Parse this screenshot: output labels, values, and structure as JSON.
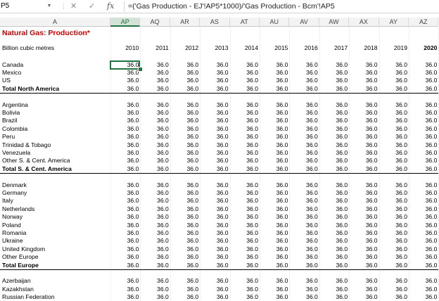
{
  "formula_bar": {
    "name_box": "P5",
    "cancel_icon": "✕",
    "enter_icon": "✓",
    "fx_label": "fx",
    "formula": "=('Gas Production - EJ'!AP5*1000)/'Gas Production - Bcm'!AP5"
  },
  "columns": [
    "A",
    "AP",
    "AQ",
    "AR",
    "AS",
    "AT",
    "AU",
    "AV",
    "AW",
    "AX",
    "AY",
    "AZ"
  ],
  "selected_column": "AP",
  "title": "Natural Gas: Production*",
  "unit_label": "Billion cubic metres",
  "years": [
    "2010",
    "2011",
    "2012",
    "2013",
    "2014",
    "2015",
    "2016",
    "2017",
    "2018",
    "2019",
    "2020"
  ],
  "rows": [
    {
      "label": "Canada",
      "values": [
        "36.0",
        "36.0",
        "36.0",
        "36.0",
        "36.0",
        "36.0",
        "36.0",
        "36.0",
        "36.0",
        "36.0",
        "36.0"
      ]
    },
    {
      "label": "Mexico",
      "values": [
        "36.0",
        "36.0",
        "36.0",
        "36.0",
        "36.0",
        "36.0",
        "36.0",
        "36.0",
        "36.0",
        "36.0",
        "36.0"
      ]
    },
    {
      "label": "US",
      "values": [
        "36.0",
        "36.0",
        "36.0",
        "36.0",
        "36.0",
        "36.0",
        "36.0",
        "36.0",
        "36.0",
        "36.0",
        "36.0"
      ]
    },
    {
      "label": "Total North America",
      "total": true,
      "values": [
        "36.0",
        "36.0",
        "36.0",
        "36.0",
        "36.0",
        "36.0",
        "36.0",
        "36.0",
        "36.0",
        "36.0",
        "36.0"
      ]
    },
    {
      "label": "",
      "blank": true
    },
    {
      "label": "Argentina",
      "values": [
        "36.0",
        "36.0",
        "36.0",
        "36.0",
        "36.0",
        "36.0",
        "36.0",
        "36.0",
        "36.0",
        "36.0",
        "36.0"
      ]
    },
    {
      "label": "Bolivia",
      "values": [
        "36.0",
        "36.0",
        "36.0",
        "36.0",
        "36.0",
        "36.0",
        "36.0",
        "36.0",
        "36.0",
        "36.0",
        "36.0"
      ]
    },
    {
      "label": "Brazil",
      "values": [
        "36.0",
        "36.0",
        "36.0",
        "36.0",
        "36.0",
        "36.0",
        "36.0",
        "36.0",
        "36.0",
        "36.0",
        "36.0"
      ]
    },
    {
      "label": "Colombia",
      "values": [
        "36.0",
        "36.0",
        "36.0",
        "36.0",
        "36.0",
        "36.0",
        "36.0",
        "36.0",
        "36.0",
        "36.0",
        "36.0"
      ]
    },
    {
      "label": "Peru",
      "values": [
        "36.0",
        "36.0",
        "36.0",
        "36.0",
        "36.0",
        "36.0",
        "36.0",
        "36.0",
        "36.0",
        "36.0",
        "36.0"
      ]
    },
    {
      "label": "Trinidad & Tobago",
      "values": [
        "36.0",
        "36.0",
        "36.0",
        "36.0",
        "36.0",
        "36.0",
        "36.0",
        "36.0",
        "36.0",
        "36.0",
        "36.0"
      ]
    },
    {
      "label": "Venezuela",
      "values": [
        "36.0",
        "36.0",
        "36.0",
        "36.0",
        "36.0",
        "36.0",
        "36.0",
        "36.0",
        "36.0",
        "36.0",
        "36.0"
      ]
    },
    {
      "label": "Other S. & Cent. America",
      "values": [
        "36.0",
        "36.0",
        "36.0",
        "36.0",
        "36.0",
        "36.0",
        "36.0",
        "36.0",
        "36.0",
        "36.0",
        "36.0"
      ]
    },
    {
      "label": "Total S. & Cent. America",
      "total": true,
      "values": [
        "36.0",
        "36.0",
        "36.0",
        "36.0",
        "36.0",
        "36.0",
        "36.0",
        "36.0",
        "36.0",
        "36.0",
        "36.0"
      ]
    },
    {
      "label": "",
      "blank": true
    },
    {
      "label": "Denmark",
      "values": [
        "36.0",
        "36.0",
        "36.0",
        "36.0",
        "36.0",
        "36.0",
        "36.0",
        "36.0",
        "36.0",
        "36.0",
        "36.0"
      ]
    },
    {
      "label": "Germany",
      "values": [
        "36.0",
        "36.0",
        "36.0",
        "36.0",
        "36.0",
        "36.0",
        "36.0",
        "36.0",
        "36.0",
        "36.0",
        "36.0"
      ]
    },
    {
      "label": "Italy",
      "values": [
        "36.0",
        "36.0",
        "36.0",
        "36.0",
        "36.0",
        "36.0",
        "36.0",
        "36.0",
        "36.0",
        "36.0",
        "36.0"
      ]
    },
    {
      "label": "Netherlands",
      "values": [
        "36.0",
        "36.0",
        "36.0",
        "36.0",
        "36.0",
        "36.0",
        "36.0",
        "36.0",
        "36.0",
        "36.0",
        "36.0"
      ]
    },
    {
      "label": "Norway",
      "values": [
        "36.0",
        "36.0",
        "36.0",
        "36.0",
        "36.0",
        "36.0",
        "36.0",
        "36.0",
        "36.0",
        "36.0",
        "36.0"
      ]
    },
    {
      "label": "Poland",
      "values": [
        "36.0",
        "36.0",
        "36.0",
        "36.0",
        "36.0",
        "36.0",
        "36.0",
        "36.0",
        "36.0",
        "36.0",
        "36.0"
      ]
    },
    {
      "label": "Romania",
      "values": [
        "36.0",
        "36.0",
        "36.0",
        "36.0",
        "36.0",
        "36.0",
        "36.0",
        "36.0",
        "36.0",
        "36.0",
        "36.0"
      ]
    },
    {
      "label": "Ukraine",
      "values": [
        "36.0",
        "36.0",
        "36.0",
        "36.0",
        "36.0",
        "36.0",
        "36.0",
        "36.0",
        "36.0",
        "36.0",
        "36.0"
      ]
    },
    {
      "label": "United Kingdom",
      "values": [
        "36.0",
        "36.0",
        "36.0",
        "36.0",
        "36.0",
        "36.0",
        "36.0",
        "36.0",
        "36.0",
        "36.0",
        "36.0"
      ]
    },
    {
      "label": "Other Europe",
      "values": [
        "36.0",
        "36.0",
        "36.0",
        "36.0",
        "36.0",
        "36.0",
        "36.0",
        "36.0",
        "36.0",
        "36.0",
        "36.0"
      ]
    },
    {
      "label": "Total Europe",
      "total": true,
      "values": [
        "36.0",
        "36.0",
        "36.0",
        "36.0",
        "36.0",
        "36.0",
        "36.0",
        "36.0",
        "36.0",
        "36.0",
        "36.0"
      ]
    },
    {
      "label": "",
      "blank": true
    },
    {
      "label": "Azerbaijan",
      "values": [
        "36.0",
        "36.0",
        "36.0",
        "36.0",
        "36.0",
        "36.0",
        "36.0",
        "36.0",
        "36.0",
        "36.0",
        "36.0"
      ]
    },
    {
      "label": "Kazakhstan",
      "values": [
        "36.0",
        "36.0",
        "36.0",
        "36.0",
        "36.0",
        "36.0",
        "36.0",
        "36.0",
        "36.0",
        "36.0",
        "36.0"
      ]
    },
    {
      "label": "Russian Federation",
      "values": [
        "36.0",
        "36.0",
        "36.0",
        "36.0",
        "36.0",
        "36.0",
        "36.0",
        "36.0",
        "36.0",
        "36.0",
        "36.0"
      ]
    }
  ],
  "colors": {
    "selection": "#217346",
    "title": "#d00000"
  }
}
